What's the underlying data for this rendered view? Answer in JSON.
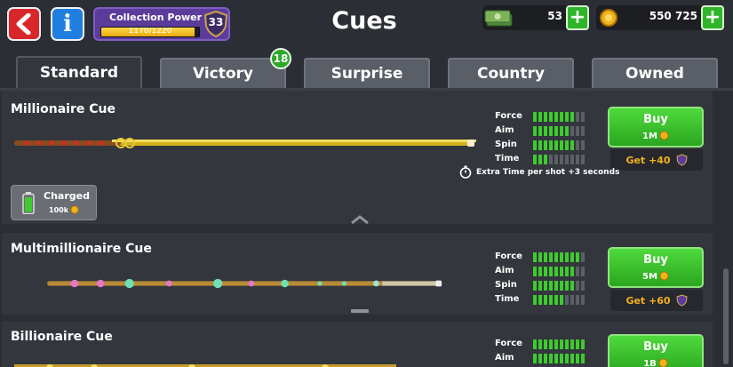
{
  "header": {
    "title": "Cues",
    "back_icon": "back-arrow-icon",
    "info_label": "i",
    "collection_power": {
      "label": "Collection Power",
      "progress_text": "1170/1220",
      "progress": 0.959,
      "level": "33"
    },
    "cash": {
      "value": "53",
      "plus": "+"
    },
    "coins": {
      "value": "550 725",
      "plus": "+"
    }
  },
  "tabs": [
    {
      "label": "Standard",
      "active": true
    },
    {
      "label": "Victory",
      "badge": "18"
    },
    {
      "label": "Surprise"
    },
    {
      "label": "Country"
    },
    {
      "label": "Owned"
    }
  ],
  "stat_labels": [
    "Force",
    "Aim",
    "Spin",
    "Time"
  ],
  "cues": [
    {
      "name": "Millionaire Cue",
      "stats": [
        8,
        7,
        8,
        3
      ],
      "buy_label": "Buy",
      "price": "1M",
      "get_label": "Get +40",
      "extra": "Extra Time per shot +3 seconds",
      "charged": {
        "label": "Charged",
        "price": "100k"
      }
    },
    {
      "name": "Multimillionaire Cue",
      "stats": [
        9,
        8,
        8,
        6
      ],
      "buy_label": "Buy",
      "price": "5M",
      "get_label": "Get +60"
    },
    {
      "name": "Billionaire Cue",
      "stats": [
        10,
        10
      ],
      "buy_label": "Buy",
      "price": "1B"
    }
  ],
  "colors": {
    "accent_green": "#3ecb2e",
    "back_red": "#d9262a",
    "info_blue": "#1f7fe0",
    "gold": "#f3b11b",
    "purple": "#5b3c9a"
  }
}
